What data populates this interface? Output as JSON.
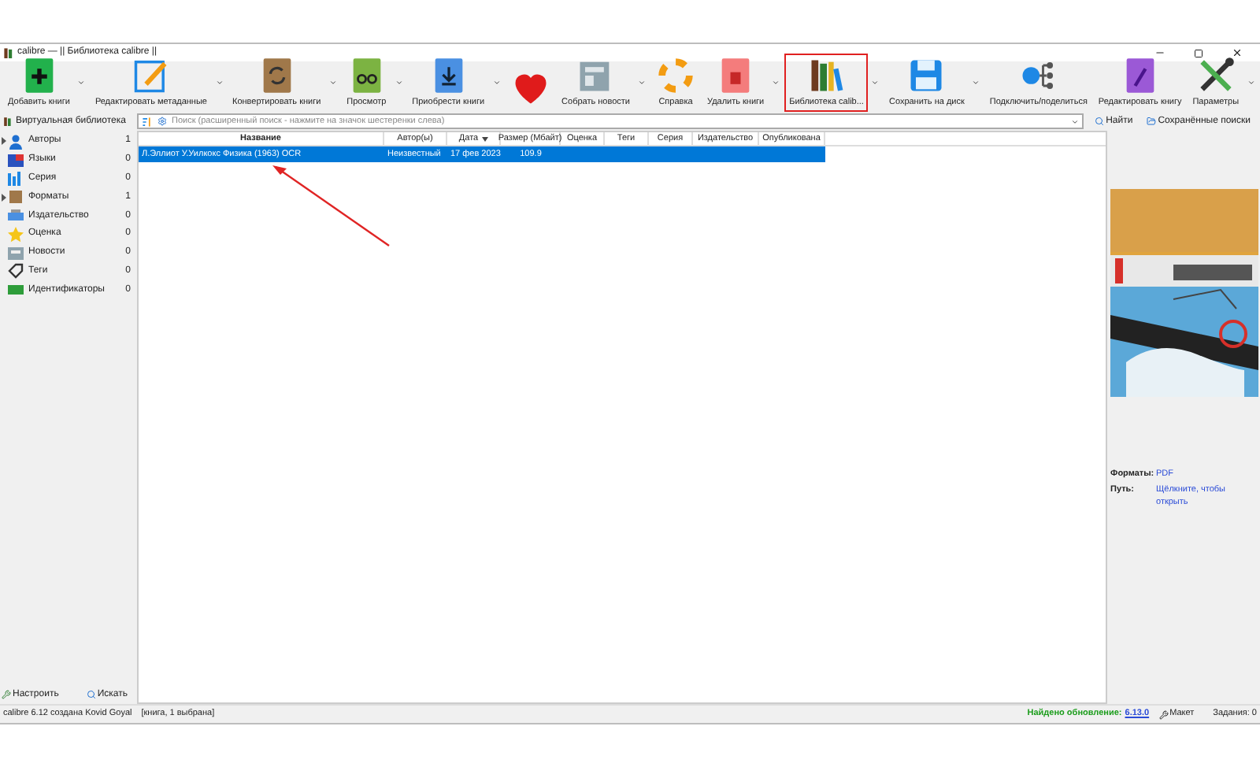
{
  "window": {
    "title": "calibre — || Библиотека calibre ||"
  },
  "toolbar": [
    {
      "kind": "add",
      "label": "Добавить книги",
      "menu": true,
      "highlighted": false
    },
    {
      "kind": "edit",
      "label": "Редактировать метаданные",
      "menu": true,
      "highlighted": false
    },
    {
      "kind": "convert",
      "label": "Конвертировать книги",
      "menu": true,
      "highlighted": false
    },
    {
      "kind": "view",
      "label": "Просмотр",
      "menu": true,
      "highlighted": false
    },
    {
      "kind": "get",
      "label": "Приобрести книги",
      "menu": true,
      "highlighted": false
    },
    {
      "kind": "heart",
      "menu": false,
      "highlighted": false
    },
    {
      "kind": "news",
      "label": "Собрать новости",
      "menu": true,
      "highlighted": false
    },
    {
      "kind": "help",
      "label": "Справка",
      "menu": false,
      "highlighted": false
    },
    {
      "kind": "remove",
      "label": "Удалить книги",
      "menu": true,
      "highlighted": false
    },
    {
      "kind": "library",
      "label": "Библиотека calib...",
      "menu": true,
      "highlighted": true
    },
    {
      "kind": "save",
      "label": "Сохранить на диск",
      "menu": true,
      "highlighted": false
    },
    {
      "kind": "connect",
      "label": "Подключить/поделиться",
      "menu": false,
      "highlighted": false
    },
    {
      "kind": "editbook",
      "label": "Редактировать книгу",
      "menu": false,
      "highlighted": false
    },
    {
      "kind": "prefs",
      "label": "Параметры",
      "menu": true,
      "highlighted": false
    }
  ],
  "search": {
    "virtual_library": "Виртуальная библиотека",
    "placeholder": "Поиск (расширенный поиск - нажмите на значок шестеренки слева)",
    "find": "Найти",
    "saved": "Сохранённые поиски"
  },
  "sidebar": {
    "items": [
      {
        "kind": "authors",
        "label": "Авторы",
        "count": "1",
        "expandable": true
      },
      {
        "kind": "languages",
        "label": "Языки",
        "count": "0",
        "expandable": false
      },
      {
        "kind": "series",
        "label": "Серия",
        "count": "0",
        "expandable": false
      },
      {
        "kind": "formats",
        "label": "Форматы",
        "count": "1",
        "expandable": true
      },
      {
        "kind": "publisher",
        "label": "Издательство",
        "count": "0",
        "expandable": false
      },
      {
        "kind": "rating",
        "label": "Оценка",
        "count": "0",
        "expandable": false
      },
      {
        "kind": "news",
        "label": "Новости",
        "count": "0",
        "expandable": false
      },
      {
        "kind": "tags",
        "label": "Теги",
        "count": "0",
        "expandable": false
      },
      {
        "kind": "ids",
        "label": "Идентификаторы",
        "count": "0",
        "expandable": false
      }
    ],
    "configure": "Настроить",
    "find": "Искать"
  },
  "table": {
    "columns": [
      {
        "label": "Название",
        "sorted": false
      },
      {
        "label": "Автор(ы)",
        "sorted": false
      },
      {
        "label": "Дата",
        "sorted": true
      },
      {
        "label": "Размер (Мбайт)",
        "sorted": false
      },
      {
        "label": "Оценка",
        "sorted": false
      },
      {
        "label": "Теги",
        "sorted": false
      },
      {
        "label": "Серия",
        "sorted": false
      },
      {
        "label": "Издательство",
        "sorted": false
      },
      {
        "label": "Опубликована",
        "sorted": false
      }
    ],
    "rows": [
      {
        "selected": true,
        "cells": [
          "Л.Эллиот У.Уилкокс Физика (1963) OCR",
          "Неизвестный",
          "17 фев 2023",
          "109.9",
          "",
          "",
          "",
          "",
          ""
        ]
      }
    ]
  },
  "details": {
    "fields": [
      {
        "label": "Форматы:",
        "value": "PDF"
      },
      {
        "label": "Путь:",
        "value": "Щёлкните, чтобы открыть"
      }
    ]
  },
  "status_bar": {
    "left": "calibre 6.12 создана Kovid Goyal",
    "selection": "[книга, 1 выбрана]",
    "update_label": "Найдено обновление:",
    "update_version": "6.13.0",
    "layout": "Макет",
    "jobs": "Задания: 0"
  }
}
